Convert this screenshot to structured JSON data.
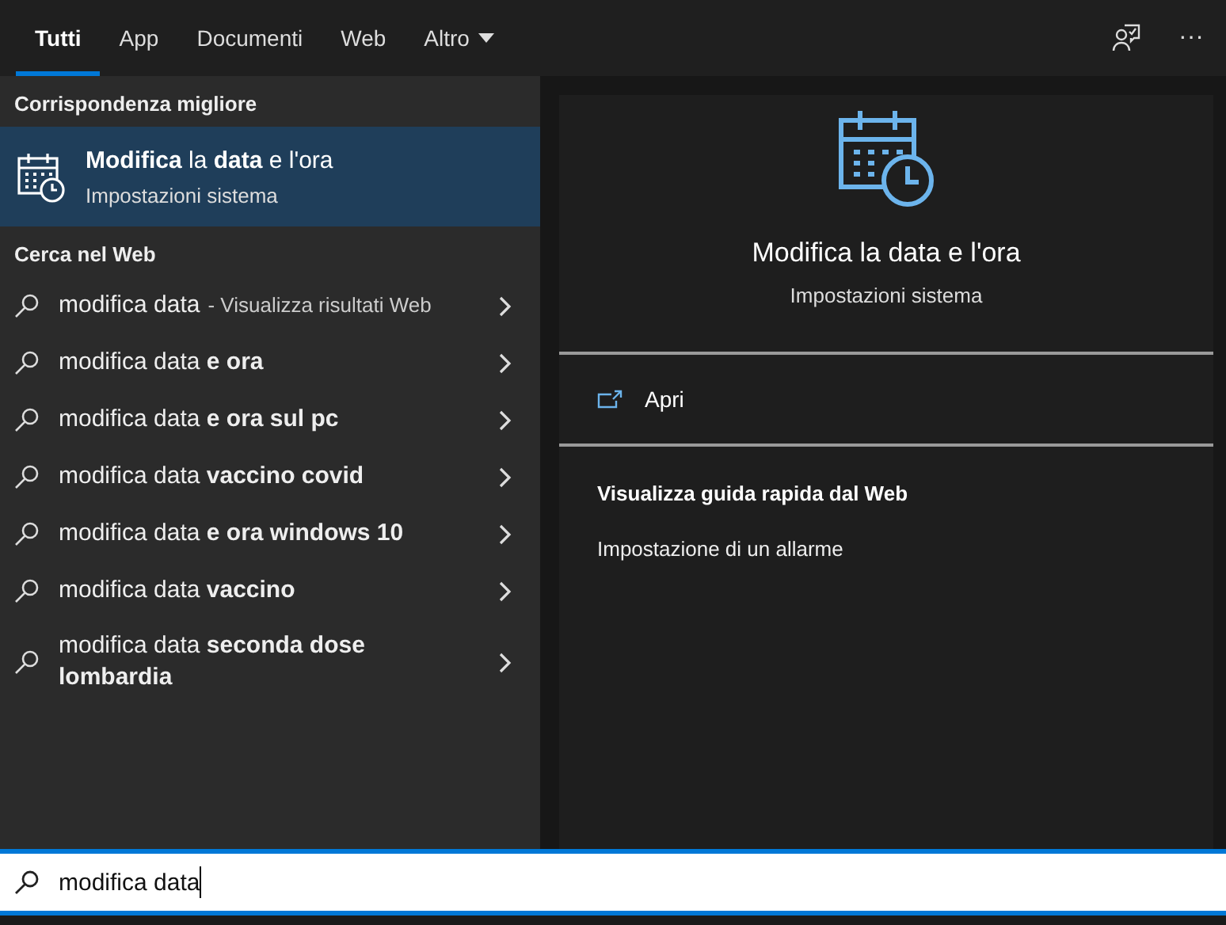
{
  "tabs": [
    {
      "label": "Tutti",
      "selected": true,
      "dropdown": false
    },
    {
      "label": "App",
      "selected": false,
      "dropdown": false
    },
    {
      "label": "Documenti",
      "selected": false,
      "dropdown": false
    },
    {
      "label": "Web",
      "selected": false,
      "dropdown": false
    },
    {
      "label": "Altro",
      "selected": false,
      "dropdown": true
    }
  ],
  "toolbar": {
    "more": "···"
  },
  "best_match": {
    "heading": "Corrispondenza migliore",
    "title": "**Modifica** la **data** e l'ora",
    "subtitle": "Impostazioni sistema",
    "selected": true
  },
  "web": {
    "heading": "Cerca nel Web",
    "items": [
      {
        "text": "modifica data",
        "suffix": "- Visualizza risultati Web"
      },
      {
        "text": "modifica data **e ora**"
      },
      {
        "text": "modifica data **e ora sul pc**"
      },
      {
        "text": "modifica data **vaccino covid**"
      },
      {
        "text": "modifica data **e ora windows 10**"
      },
      {
        "text": "modifica data **vaccino**"
      },
      {
        "text": "modifica data **seconda dose lombardia**"
      }
    ]
  },
  "preview": {
    "title": "Modifica la data e l'ora",
    "subtitle": "Impostazioni sistema",
    "action": "Apri",
    "guide_heading": "Visualizza guida rapida dal Web",
    "guide_items": [
      "Impostazione di un allarme"
    ]
  },
  "search": {
    "value": "modifica data"
  }
}
